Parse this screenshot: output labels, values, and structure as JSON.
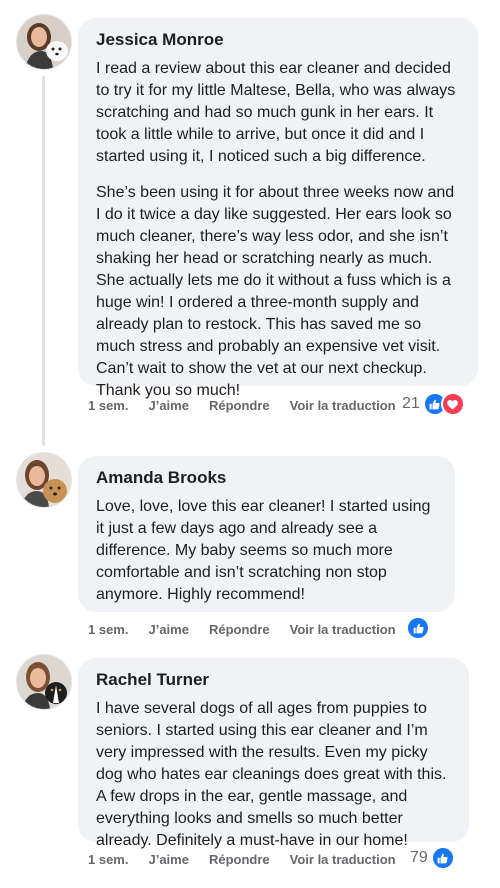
{
  "colors": {
    "like": "#1877f2",
    "love": "#f33e58",
    "bubble": "#f0f2f5",
    "meta": "#65676b"
  },
  "comments": [
    {
      "name": "Jessica Monroe",
      "paragraphs": [
        "I read a review about this ear cleaner and decided to try it for my little Maltese, Bella, who was always scratching and had so much gunk in her ears. It took a little while to arrive, but once it did and I started using it, I noticed such a big difference.",
        "She’s been using it for about three weeks now and I do it twice a day like suggested. Her ears look so much cleaner, there’s way less odor, and she isn’t shaking her head or scratching nearly as much. She actually lets me do it without a fuss which is a huge win! I ordered a three-month supply and already plan to restock. This has saved me so much stress and probably an expensive vet visit. Can’t wait to show the vet at our next checkup. Thank you so much!"
      ],
      "time": "1 sem.",
      "like_label": "J’aime",
      "reply_label": "Répondre",
      "translate_label": "Voir la traduction",
      "reaction_count": "21",
      "reactions": [
        "like-icon",
        "love-icon"
      ]
    },
    {
      "name": "Amanda Brooks",
      "paragraphs": [
        "Love, love, love this ear cleaner! I started using it just a few days ago and already see a difference. My baby seems so much more comfortable and isn’t scratching non stop anymore. Highly recommend!"
      ],
      "time": "1 sem.",
      "like_label": "J’aime",
      "reply_label": "Répondre",
      "translate_label": "Voir la traduction",
      "reaction_count": "",
      "reactions": [
        "like-icon"
      ]
    },
    {
      "name": "Rachel Turner",
      "paragraphs": [
        "I have several dogs of all ages from puppies to seniors. I started using this ear cleaner and I’m very impressed with the results. Even my picky dog who hates ear cleanings does great with this. A few drops in the ear, gentle massage, and everything looks and smells so much better already. Definitely a must-have in our home!"
      ],
      "time": "1 sem.",
      "like_label": "J’aime",
      "reply_label": "Répondre",
      "translate_label": "Voir la traduction",
      "reaction_count": "79",
      "reactions": [
        "like-icon"
      ]
    }
  ]
}
